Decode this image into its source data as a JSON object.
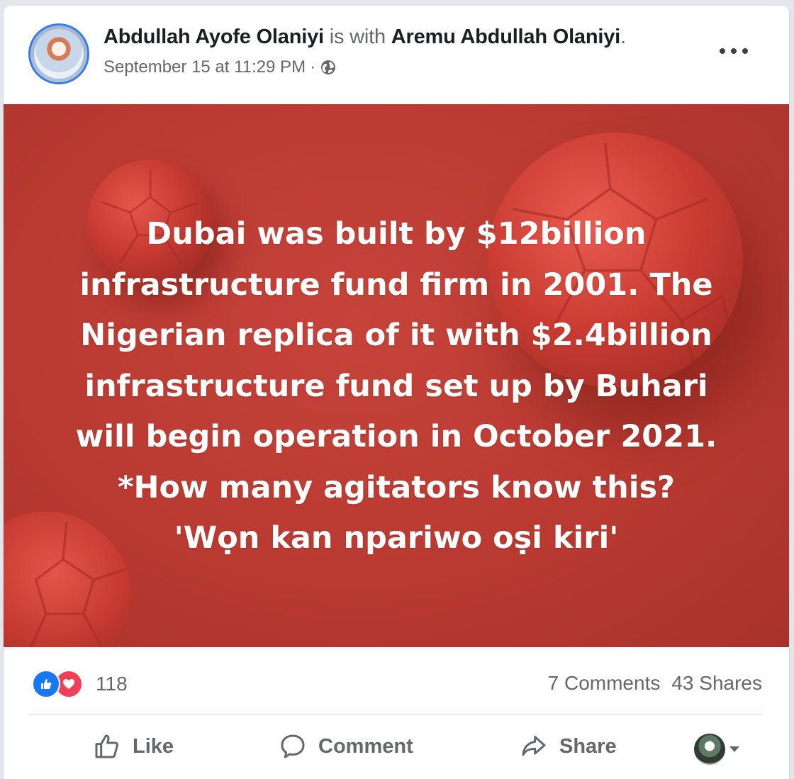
{
  "post": {
    "author": "Abdullah Ayofe Olaniyi",
    "with_text": "is with",
    "tagged": "Aremu Abdullah Olaniyi",
    "period": ".",
    "timestamp": "September 15 at 11:29 PM",
    "separator": "·",
    "audience_icon": "globe-icon",
    "more_icon": "more-options-icon"
  },
  "image_text": {
    "lines": [
      "Dubai was built by $12billion",
      "infrastructure fund firm in 2001. The",
      "Nigerian replica of it with $2.4billion",
      "infrastructure fund set up by Buhari",
      "will begin operation in October 2021.",
      "*How many agitators know this?",
      "'Wọn kan npariwo oṣi kiri'"
    ]
  },
  "stats": {
    "reactions_count": "118",
    "comments": "7 Comments",
    "shares": "43 Shares"
  },
  "actions": {
    "like": "Like",
    "comment": "Comment",
    "share": "Share"
  },
  "colors": {
    "brand_blue": "#1877f2",
    "love_red": "#f33e58",
    "image_background": "#bb3c33",
    "secondary_text": "#65676b"
  }
}
